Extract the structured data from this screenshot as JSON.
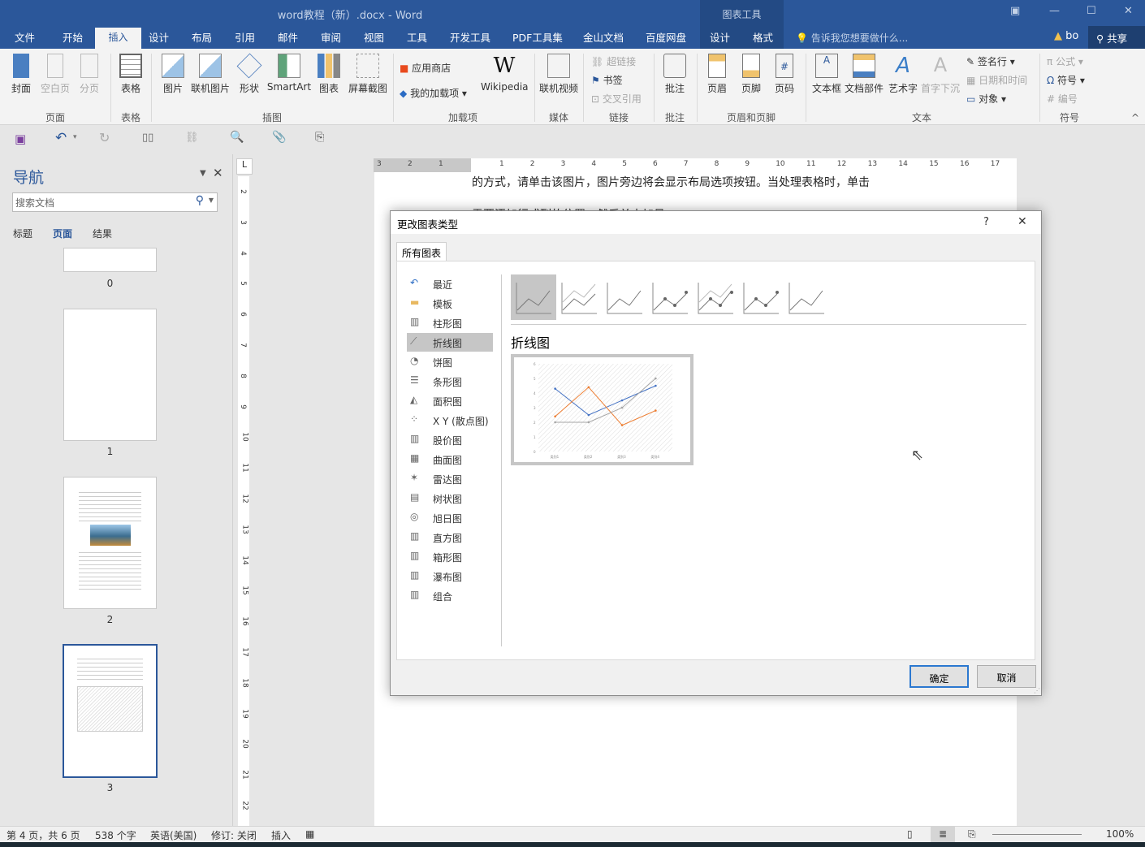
{
  "window": {
    "title": "word教程（新）.docx - Word",
    "contextual_group": "图表工具",
    "user": "bo",
    "share": "共享",
    "tell_me": "告诉我您想要做什么..."
  },
  "tabs": [
    "文件",
    "开始",
    "插入",
    "设计",
    "布局",
    "引用",
    "邮件",
    "审阅",
    "视图",
    "工具",
    "开发工具",
    "PDF工具集",
    "金山文档",
    "百度网盘",
    "设计",
    "格式"
  ],
  "ribbon": {
    "groups": [
      "页面",
      "表格",
      "插图",
      "加载项",
      "媒体",
      "链接",
      "批注",
      "页眉和页脚",
      "文本",
      "符号"
    ],
    "buttons": {
      "cover": "封面",
      "blank": "空白页",
      "break": "分页",
      "table": "表格",
      "picture": "图片",
      "online_picture": "联机图片",
      "shapes": "形状",
      "smartart": "SmartArt",
      "chart": "图表",
      "screenshot": "屏幕截图",
      "store": "应用商店",
      "my_addins": "我的加载项",
      "wikipedia": "Wikipedia",
      "online_video": "联机视频",
      "hyperlink": "超链接",
      "bookmark": "书签",
      "crossref": "交叉引用",
      "comment": "批注",
      "header": "页眉",
      "footer": "页脚",
      "page_number": "页码",
      "textbox": "文本框",
      "quick_parts": "文档部件",
      "wordart": "艺术字",
      "dropcap": "首字下沉",
      "signature": "签名行",
      "datetime": "日期和时间",
      "object": "对象",
      "equation": "公式",
      "symbol": "符号",
      "numbering": "编号"
    }
  },
  "nav": {
    "title": "导航",
    "search_placeholder": "搜索文档",
    "tabs": [
      "标题",
      "页面",
      "结果"
    ],
    "active_tab": "页面",
    "pages": [
      "0",
      "1",
      "2",
      "3"
    ],
    "selected_page": "3"
  },
  "document": {
    "line1": "的方式，请单击该图片，图片旁边将会显示布局选项按钮。当处理表格时，单击",
    "line2": "需要添加行或列的位置，然后单击加号。"
  },
  "ruler": {
    "labels": [
      "3",
      "2",
      "1",
      "1",
      "2",
      "3",
      "4",
      "5",
      "6",
      "7",
      "8",
      "9",
      "10",
      "11",
      "12",
      "13",
      "14",
      "15",
      "16",
      "17"
    ],
    "vlabels": [
      "2",
      "3",
      "4",
      "5",
      "6",
      "7",
      "8",
      "9",
      "10",
      "11",
      "12",
      "13",
      "14",
      "15",
      "16",
      "17",
      "18",
      "19",
      "20",
      "21",
      "22"
    ]
  },
  "dialog": {
    "title": "更改图表类型",
    "help": "?",
    "close": "✕",
    "tab": "所有图表",
    "types": [
      "最近",
      "模板",
      "柱形图",
      "折线图",
      "饼图",
      "条形图",
      "面积图",
      "X Y (散点图)",
      "股价图",
      "曲面图",
      "雷达图",
      "树状图",
      "旭日图",
      "直方图",
      "箱形图",
      "瀑布图",
      "组合"
    ],
    "selected_type": "折线图",
    "subtype_heading": "折线图",
    "ok": "确定",
    "cancel": "取消"
  },
  "chart_data": {
    "type": "line",
    "categories": [
      "类别1",
      "类别2",
      "类别3",
      "类别4"
    ],
    "series": [
      {
        "values": [
          4.3,
          2.5,
          3.5,
          4.5
        ],
        "color": "#4472c4"
      },
      {
        "values": [
          2.4,
          4.4,
          1.8,
          2.8
        ],
        "color": "#ed7d31"
      },
      {
        "values": [
          2,
          2,
          3,
          5
        ],
        "color": "#a5a5a5"
      }
    ],
    "ylim": [
      0,
      6
    ],
    "yticks": [
      "0",
      "1",
      "2",
      "3",
      "4",
      "5",
      "6"
    ],
    "grid": false
  },
  "status": {
    "page": "第 4 页，共 6 页",
    "words": "538 个字",
    "lang": "英语(美国)",
    "track": "修订: 关闭",
    "mode": "插入",
    "zoom": "100%"
  },
  "colors": {
    "accent": "#2b579a"
  }
}
